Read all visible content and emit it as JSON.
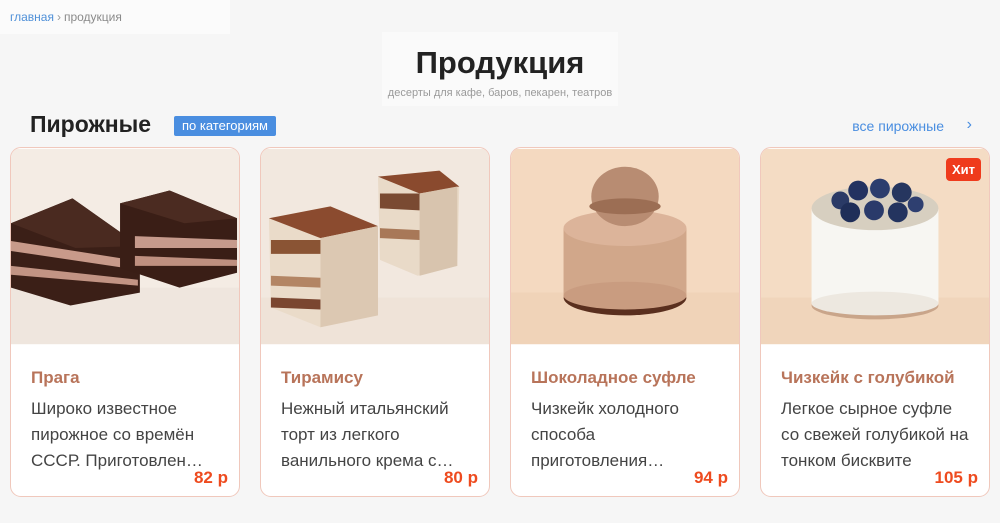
{
  "breadcrumb": {
    "home": "главная",
    "separator": "›",
    "current": "продукция"
  },
  "header": {
    "title": "Продукция",
    "subtitle": "десерты для кафе, баров, пекарен, театров"
  },
  "section": {
    "title": "Пирожные",
    "category_badge": "по категориям",
    "all_link": "все пирожные",
    "chevron_icon": "chevron-right-icon"
  },
  "colors": {
    "accent": "#4a8ee0",
    "product_name": "#b8745a",
    "price": "#ee4b1f",
    "hit_badge": "#ef3b1c",
    "card_border": "#f0c8bc"
  },
  "products": [
    {
      "name": "Прага",
      "description": "Широко известное пирожное со времён СССР. Приготовлен…",
      "price": "82 р"
    },
    {
      "name": "Тирамису",
      "description": "Нежный итальянский торт из легкого ванильного крема с…",
      "price": "80 р"
    },
    {
      "name": "Шоколадное суфле",
      "description": "Чизкейк холодного способа приготовления…",
      "price": "94 р"
    },
    {
      "name": "Чизкейк с голубикой",
      "description": "Легкое сырное суфле со свежей голубикой на тонком бисквите",
      "price": "105 р",
      "badge": "Хит"
    }
  ]
}
